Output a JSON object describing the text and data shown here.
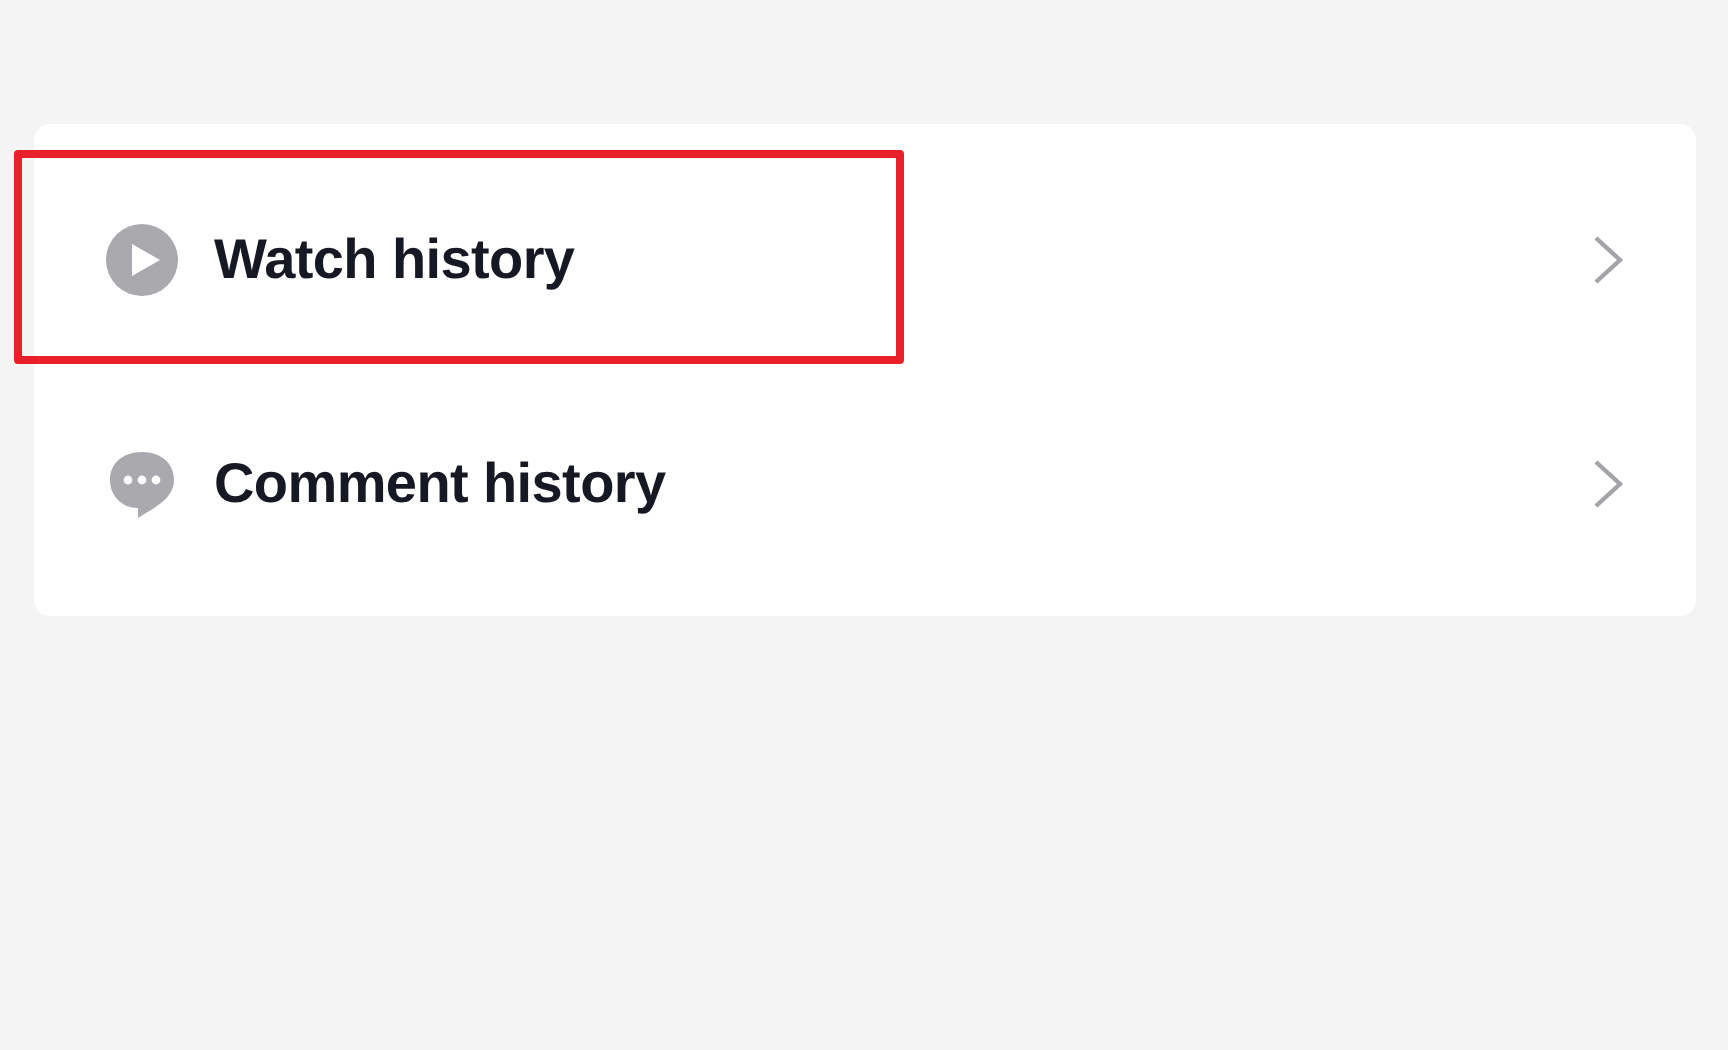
{
  "menu": {
    "items": [
      {
        "kind": "play",
        "label": "Watch history",
        "highlighted": true
      },
      {
        "kind": "comment",
        "label": "Comment history",
        "highlighted": false
      }
    ]
  }
}
